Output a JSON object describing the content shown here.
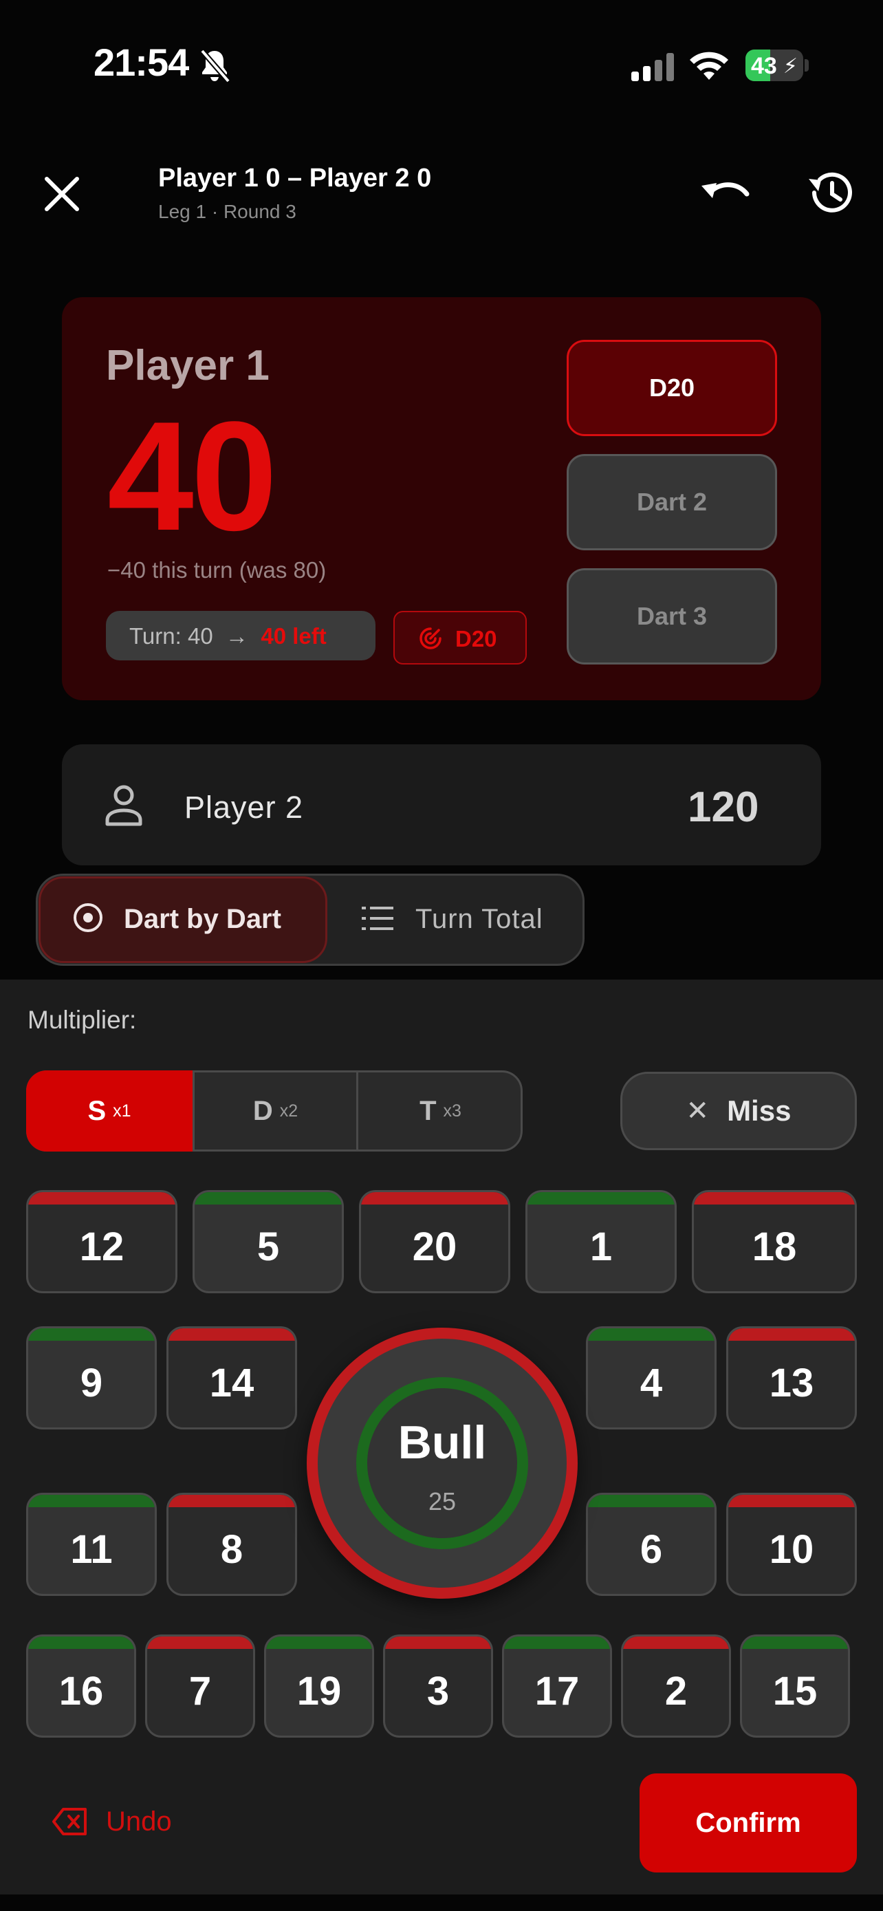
{
  "status_bar": {
    "time": "21:54",
    "battery_level": "43",
    "battery_percent": 43,
    "icons": [
      "bell-slash-icon",
      "signal-icon",
      "wifi-icon",
      "battery-charging-icon"
    ]
  },
  "header": {
    "title": "Player 1 0 – Player 2 0",
    "subtitle": "Leg 1 · Round 3",
    "icons": [
      "close-icon",
      "undo-icon",
      "history-icon"
    ]
  },
  "active_player": {
    "name": "Player 1",
    "score": "40",
    "delta_text": "−40 this turn  (was 80)",
    "turn_label": "Turn: 40",
    "arrow": "→",
    "left_text": "40 left",
    "last_dart": "D20",
    "darts": [
      "D20",
      "Dart 2",
      "Dart 3"
    ]
  },
  "other_player": {
    "name": "Player 2",
    "score": "120"
  },
  "modes": {
    "dart_by_dart": "Dart by Dart",
    "turn_total": "Turn Total",
    "selected": "dart_by_dart"
  },
  "panel": {
    "multiplier_label": "Multiplier:",
    "multipliers": [
      {
        "letter": "S",
        "factor": "x1",
        "selected": true
      },
      {
        "letter": "D",
        "factor": "x2",
        "selected": false
      },
      {
        "letter": "T",
        "factor": "x3",
        "selected": false
      }
    ],
    "miss_label": "Miss",
    "row1": [
      {
        "n": "12",
        "color": "red"
      },
      {
        "n": "5",
        "color": "green"
      },
      {
        "n": "20",
        "color": "red"
      },
      {
        "n": "1",
        "color": "green"
      },
      {
        "n": "18",
        "color": "red"
      }
    ],
    "left_pad": [
      {
        "n": "9",
        "color": "green"
      },
      {
        "n": "14",
        "color": "red"
      },
      {
        "n": "11",
        "color": "green"
      },
      {
        "n": "8",
        "color": "red"
      }
    ],
    "right_pad": [
      {
        "n": "4",
        "color": "green"
      },
      {
        "n": "13",
        "color": "red"
      },
      {
        "n": "6",
        "color": "green"
      },
      {
        "n": "10",
        "color": "red"
      }
    ],
    "bottom_row": [
      {
        "n": "16",
        "color": "green"
      },
      {
        "n": "7",
        "color": "red"
      },
      {
        "n": "19",
        "color": "green"
      },
      {
        "n": "3",
        "color": "red"
      },
      {
        "n": "17",
        "color": "green"
      },
      {
        "n": "2",
        "color": "red"
      },
      {
        "n": "15",
        "color": "green"
      }
    ],
    "bull_label": "Bull",
    "bull_value": "25",
    "undo_label": "Undo",
    "confirm_label": "Confirm"
  },
  "colors": {
    "accent_red": "#d20202",
    "segment_red": "#bb1b1e",
    "segment_green": "#1d6a20",
    "card_active_bg": "#300305",
    "battery_green": "#34c759"
  }
}
